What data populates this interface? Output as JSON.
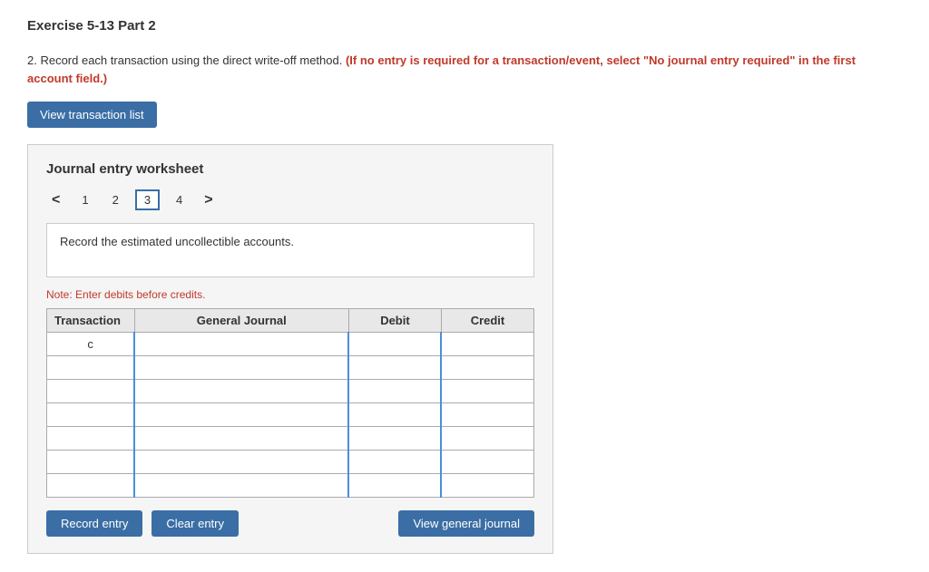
{
  "page": {
    "exercise_title": "Exercise 5-13 Part 2",
    "instruction_prefix": "2. Record each transaction using the direct write-off method.",
    "instruction_highlight": "(If no entry is required for a transaction/event, select \"No journal entry required\" in the first account field.)",
    "view_transaction_btn": "View transaction list",
    "worksheet": {
      "title": "Journal entry worksheet",
      "nav": {
        "prev_arrow": "<",
        "next_arrow": ">",
        "tabs": [
          {
            "label": "1",
            "active": false
          },
          {
            "label": "2",
            "active": false
          },
          {
            "label": "3",
            "active": true
          },
          {
            "label": "4",
            "active": false
          }
        ]
      },
      "description": "Record the estimated uncollectible accounts.",
      "note": "Note: Enter debits before credits.",
      "table": {
        "headers": [
          "Transaction",
          "General Journal",
          "Debit",
          "Credit"
        ],
        "first_row_transaction": "c",
        "rows_count": 7
      },
      "buttons": {
        "record_entry": "Record entry",
        "clear_entry": "Clear entry",
        "view_general_journal": "View general journal"
      }
    }
  }
}
